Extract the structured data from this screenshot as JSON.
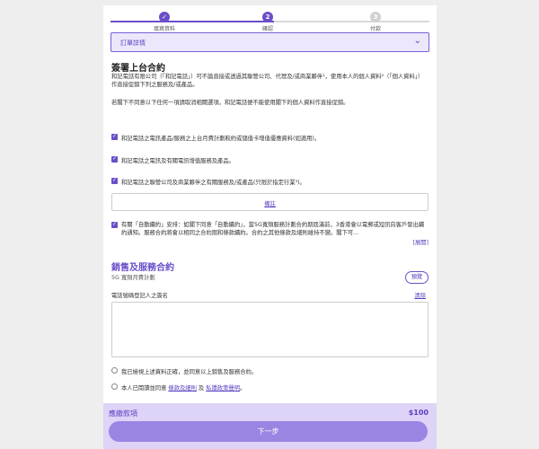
{
  "stepper": {
    "steps": [
      {
        "number": "✓",
        "label": "填寫資料"
      },
      {
        "number": "2",
        "label": "確認"
      },
      {
        "number": "3",
        "label": "付款"
      }
    ]
  },
  "order_details": {
    "label": "訂單詳情",
    "chevron": "⌄"
  },
  "direct_marketing": {
    "title": "簽署上台合約",
    "intro": "和記電話有限公司（「和記電話」）可不論直接或透過其聯營公司、代理及/或商業夥伴¹，使用本人的個人資料²（「個人資料」）作直接促銷下列之服務及/或產品。",
    "opt_out": "若閣下不同意以下任何一項請取消相關選項，和記電話便不能使用閣下的個人資料作直接促銷。",
    "options": [
      "和記電話之電訊產品/服務之上台月費計劃較約或儲值卡增值優惠資料(如適用)。",
      "和記電話之電訊及有關電訊增值服務及產品。",
      "和記電話之聯營公司及商業夥伴之有關服務及/或產品(只限於指定行業³)。"
    ],
    "notes_label": "備註",
    "auto_renew": "有關「自動續約」安排：如閣下同意「自動續約」，當5G寬頻服務計劃合約期屆滿前，3香港會以電郵或短訊向客戶發出續約通知。服務合約將會以相同之合約期和條款續約。合約之其他條款及細則維持不變。閣下可...",
    "expand_label": "[展開]"
  },
  "contract": {
    "title": "銷售及服務合約",
    "plan": "5G 寬頻月費計劃",
    "preview_label": "預覽",
    "signature_label": "電話號碼登記人之簽名",
    "clear_label": "清除",
    "confirm_1": "我已檢視上述資料正確，並同意以上銷售及服務合約。",
    "confirm_2_prefix": "本人已閱讀並同意",
    "terms_link": "條款及細則",
    "and": "及",
    "privacy_link": "私隱政策聲明",
    "suffix": "。"
  },
  "footer": {
    "due_label": "應繳款項",
    "amount": "$100",
    "next_label": "下一步"
  },
  "colors": {
    "accent": "#6b4fc9",
    "footer_bg": "#ddd4f7",
    "button": "#9b85e3"
  }
}
